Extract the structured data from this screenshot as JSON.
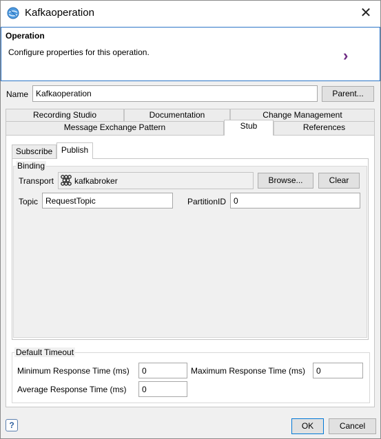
{
  "window": {
    "title": "Kafkaoperation",
    "close_symbol": "✕"
  },
  "banner": {
    "title": "Operation",
    "description": "Configure properties for this operation.",
    "arrow_symbol": "›"
  },
  "name_row": {
    "label": "Name",
    "value": "Kafkaoperation",
    "parent_button": "Parent..."
  },
  "tabs": {
    "row1": [
      "Recording Studio",
      "Documentation",
      "Change Management"
    ],
    "row2": [
      "Message Exchange Pattern",
      "Stub",
      "References"
    ],
    "active": "Stub"
  },
  "subtabs": {
    "items": [
      "Subscribe",
      "Publish"
    ],
    "active": "Publish"
  },
  "binding": {
    "group_label": "Binding",
    "transport_label": "Transport",
    "transport_value": "kafkabroker",
    "browse_button": "Browse...",
    "clear_button": "Clear",
    "topic_label": "Topic",
    "topic_value": "RequestTopic",
    "partition_label": "PartitionID",
    "partition_value": "0"
  },
  "timeout": {
    "group_label": "Default Timeout",
    "min_label": "Minimum Response Time (ms)",
    "min_value": "0",
    "max_label": "Maximum Response Time (ms)",
    "max_value": "0",
    "avg_label": "Average Response Time (ms)",
    "avg_value": "0"
  },
  "footer": {
    "help_symbol": "?",
    "ok_button": "OK",
    "cancel_button": "Cancel"
  },
  "colors": {
    "accent": "#0078d7",
    "banner_border": "#2b74c7",
    "arrow": "#6e2a83"
  }
}
